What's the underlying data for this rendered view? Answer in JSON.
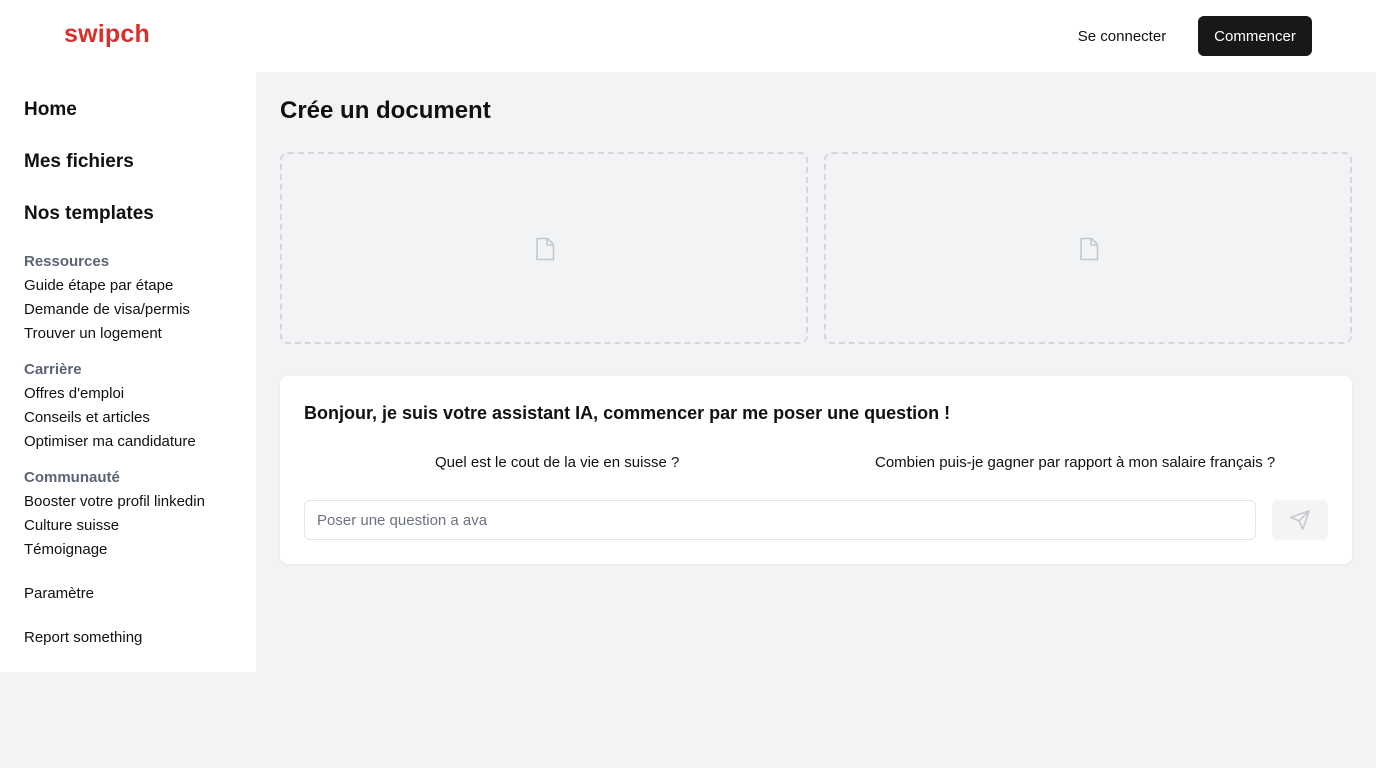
{
  "header": {
    "logo": "swipch",
    "login_label": "Se connecter",
    "start_label": "Commencer"
  },
  "sidebar": {
    "main_items": [
      {
        "label": "Home"
      },
      {
        "label": "Mes fichiers"
      },
      {
        "label": "Nos templates"
      }
    ],
    "sections": [
      {
        "title": "Ressources",
        "items": [
          "Guide étape par étape",
          "Demande de visa/permis",
          "Trouver un logement"
        ]
      },
      {
        "title": "Carrière",
        "items": [
          "Offres d'emploi",
          "Conseils et articles",
          "Optimiser ma candidature"
        ]
      },
      {
        "title": "Communauté",
        "items": [
          "Booster votre profil linkedin",
          "Culture suisse",
          "Témoignage"
        ]
      }
    ],
    "footer_items": [
      "Paramètre",
      "Report something"
    ]
  },
  "main": {
    "title": "Crée un document",
    "document_cards": [
      {
        "icon": "file-icon"
      },
      {
        "icon": "file-icon"
      }
    ]
  },
  "assistant": {
    "heading": "Bonjour, je suis votre assistant IA, commencer par me poser une question !",
    "suggestions": [
      "Quel est le cout de la vie en suisse ?",
      "Combien puis-je gagner par rapport à mon salaire français ?"
    ],
    "input_placeholder": "Poser une question a ava",
    "input_value": "",
    "send_icon": "send-icon"
  },
  "colors": {
    "brand": "#d9302c",
    "primary_button": "#18181b",
    "page_background": "#f2f3f5",
    "section_title": "#5b6474"
  }
}
